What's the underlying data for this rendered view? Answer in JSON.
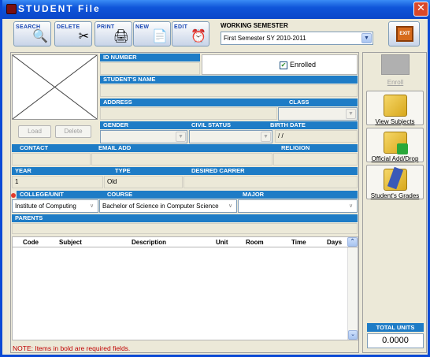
{
  "window": {
    "title": "STUDENT File",
    "close_label": "✕"
  },
  "toolbar": {
    "search": "SEARCH",
    "delete": "DELETE",
    "print": "PRINT",
    "new": "NEW",
    "edit": "EDIT",
    "exit": "EXIT"
  },
  "semester": {
    "label": "WORKING SEMESTER",
    "value": "First Semester SY 2010-2011"
  },
  "photo": {
    "load": "Load",
    "delete": "Delete"
  },
  "form": {
    "id_number_label": "ID NUMBER",
    "enrolled_label": "Enrolled",
    "enrolled_checked": true,
    "students_name_label": "STUDENT'S NAME",
    "address_label": "ADDRESS",
    "class_label": "CLASS",
    "gender_label": "GENDER",
    "civil_status_label": "CIVIL STATUS",
    "birth_date_label": "BIRTH DATE",
    "birth_date_value": "/ /",
    "contact_label": "CONTACT",
    "email_label": "EMAIL ADD",
    "religion_label": "RELIGION",
    "year_label": "YEAR",
    "year_value": "1",
    "type_label": "TYPE",
    "type_value": "Old",
    "desired_carrer_label": "DESIRED CARRER",
    "college_label": "COLLEGE/UNIT",
    "college_value": "Institute of Computing",
    "course_label": "COURSE",
    "course_value": "Bachelor of Science in Computer Science",
    "major_label": "MAJOR",
    "parents_label": "PARENTS"
  },
  "grid": {
    "columns": [
      "Code",
      "Subject",
      "Description",
      "Unit",
      "Room",
      "Time",
      "Days"
    ]
  },
  "note": "NOTE: Items in bold are required fields.",
  "sidebar": {
    "enroll": "Enroll",
    "view_subjects": "View Subjects",
    "official_add_drop": "Official Add/Drop",
    "students_grades": "Student's Grades",
    "total_units_label": "TOTAL UNITS",
    "total_units_value": "0.0000"
  },
  "colors": {
    "section_bar": "#1e7cc6",
    "title_bar": "#0f55d9",
    "note_text": "#c00000"
  }
}
